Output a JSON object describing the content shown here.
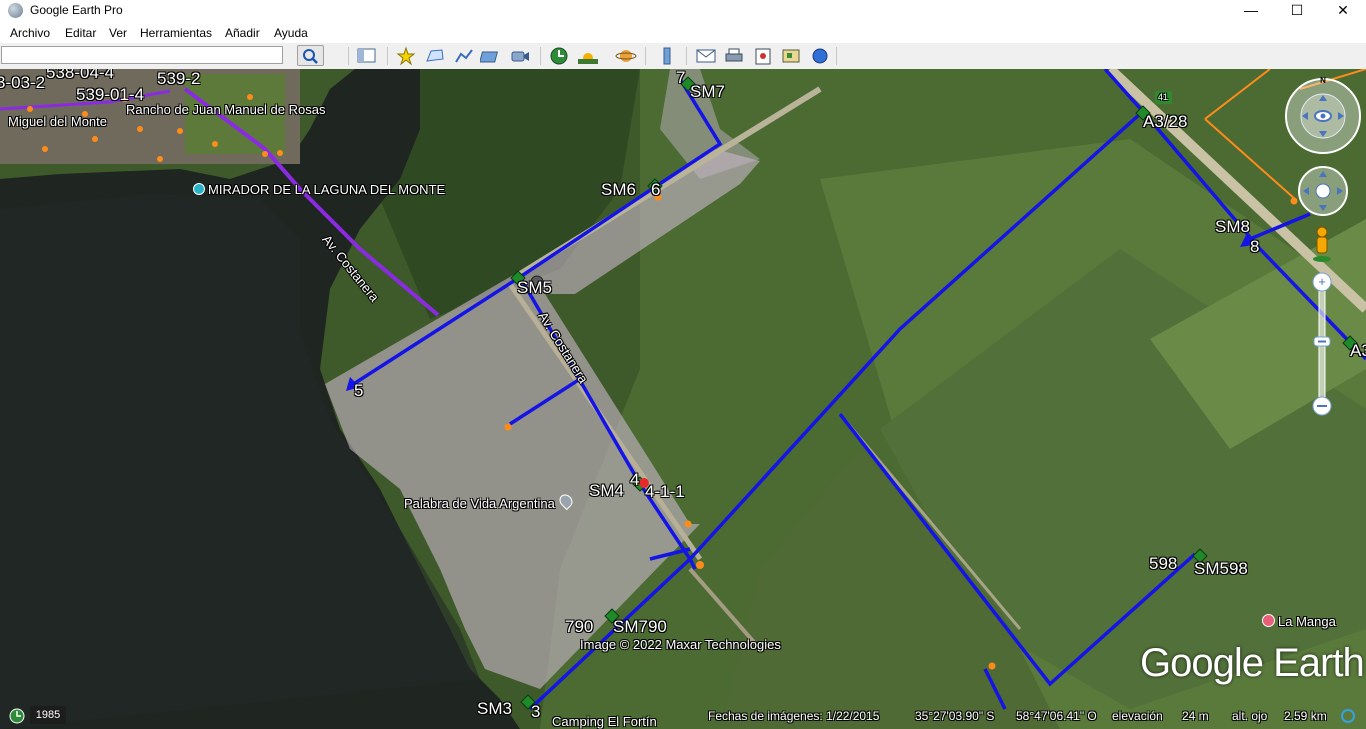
{
  "window": {
    "title": "Google Earth Pro",
    "minimize": "—",
    "maximize": "☐",
    "close": "✕"
  },
  "menu": [
    "Archivo",
    "Editar",
    "Ver",
    "Herramientas",
    "Añadir",
    "Ayuda"
  ],
  "search": {
    "value": "",
    "placeholder": ""
  },
  "toolbar_icons": [
    "sidebar-icon",
    "placemark-icon",
    "polygon-icon",
    "path-icon",
    "image-overlay-icon",
    "record-tour-icon",
    "historical-imagery-icon",
    "sunlight-icon",
    "planets-icon",
    "ruler-icon",
    "email-icon",
    "print-icon",
    "save-image-icon",
    "view-in-maps-icon",
    "earth-gallery-icon"
  ],
  "map_labels": {
    "sm7": "SM7",
    "n7": "7",
    "sm6": "SM6",
    "n6": "6",
    "sm5": "SM5",
    "n5": "5",
    "sm4": "SM4",
    "n4": "4",
    "n411": "4-1-1",
    "sm790": "SM790",
    "n790": "790",
    "sm3": "SM3",
    "n3": "3",
    "a328": "A3/28",
    "sm8": "SM8",
    "n8": "8",
    "a3": "A3",
    "n598": "598",
    "sm598": "SM598",
    "route41": "41",
    "costanera1": "Av. Costanera",
    "costanera2": "Av. Costanera",
    "rancho": "Rancho de Juan Manuel de Rosas",
    "mirador": "MIRADOR DE LA LAGUNA DEL MONTE",
    "palabra": "Palabra de Vida Argentina",
    "lamanga": "La Manga",
    "camping": "Camping El Fortín",
    "miguel": "Miguel del Monte",
    "l538": "538-04-4",
    "l53903": "3-03-2",
    "l53901": "539-01-4",
    "l5392": "539-2",
    "imagery_credit": "Image © 2022 Maxar Technologies"
  },
  "status": {
    "imagery_date_label": "Fechas de imágenes: 1/22/2015",
    "lat": "35°27'03.90\" S",
    "lon": "58°47'06.41\" O",
    "elev_label": "elevación",
    "elev_value": "24 m",
    "eye_label": "alt. ojo",
    "eye_value": "2.59 km",
    "year": "1985"
  },
  "logo": "Google Earth",
  "colors": {
    "route_blue": "#1414e6",
    "purple": "#8a2be2",
    "orange": "#ff8c1a"
  }
}
